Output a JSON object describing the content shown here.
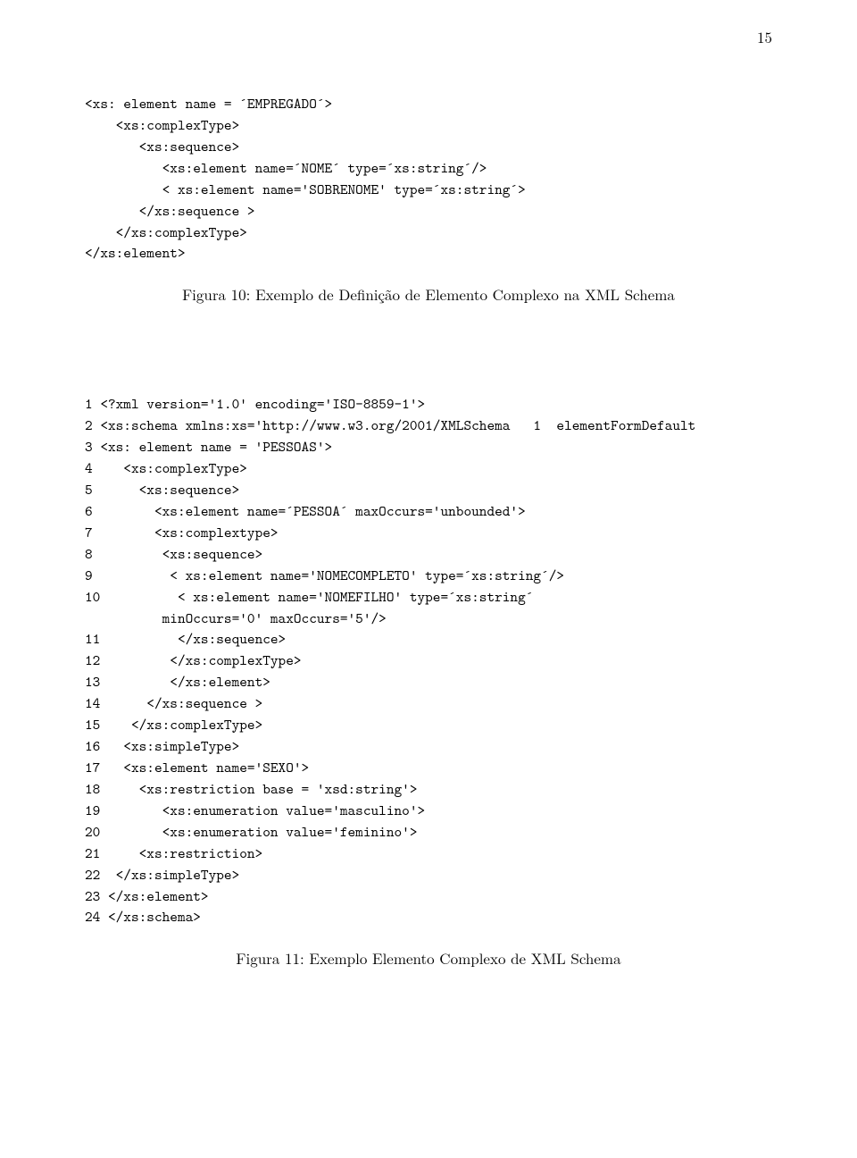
{
  "page_number": "15",
  "code_block_1": {
    "lines": [
      "<xs: element name = ´EMPREGADO´>",
      "    <xs:complexType>",
      "       <xs:sequence>",
      "          <xs:element name=´NOME´ type=´xs:string´/>",
      "          < xs:element name='SOBRENOME' type=´xs:string´>",
      "       </xs:sequence >",
      "    </xs:complexType>",
      "</xs:element>"
    ]
  },
  "caption_1": "Figura 10: Exemplo de Definição de Elemento Complexo na XML Schema",
  "code_block_2": {
    "lines": [
      "1 <?xml version='1.0' encoding='ISO-8859-1'>",
      "2 <xs:schema xmlns:xs='http://www.w3.org/2001/XMLSchema   1  elementFormDefault",
      "3 <xs: element name = 'PESSOAS'>",
      "4    <xs:complexType>",
      "5      <xs:sequence>",
      "6        <xs:element name=´PESSOA´ maxOccurs='unbounded'>",
      "7        <xs:complextype>",
      "8         <xs:sequence>",
      "9          < xs:element name='NOMECOMPLETO' type=´xs:string´/>",
      "10          < xs:element name='NOMEFILHO' type=´xs:string´",
      "          minOccurs='0' maxOccurs='5'/>",
      "11          </xs:sequence>",
      "12         </xs:complexType>",
      "13         </xs:element>",
      "14      </xs:sequence >",
      "15    </xs:complexType>",
      "16   <xs:simpleType>",
      "17   <xs:element name='SEXO'>",
      "18     <xs:restriction base = 'xsd:string'>",
      "19        <xs:enumeration value='masculino'>",
      "20        <xs:enumeration value='feminino'>",
      "21     <xs:restriction>",
      "22  </xs:simpleType>",
      "23 </xs:element>",
      "24 </xs:schema>"
    ]
  },
  "caption_2": "Figura 11: Exemplo Elemento Complexo de XML Schema"
}
